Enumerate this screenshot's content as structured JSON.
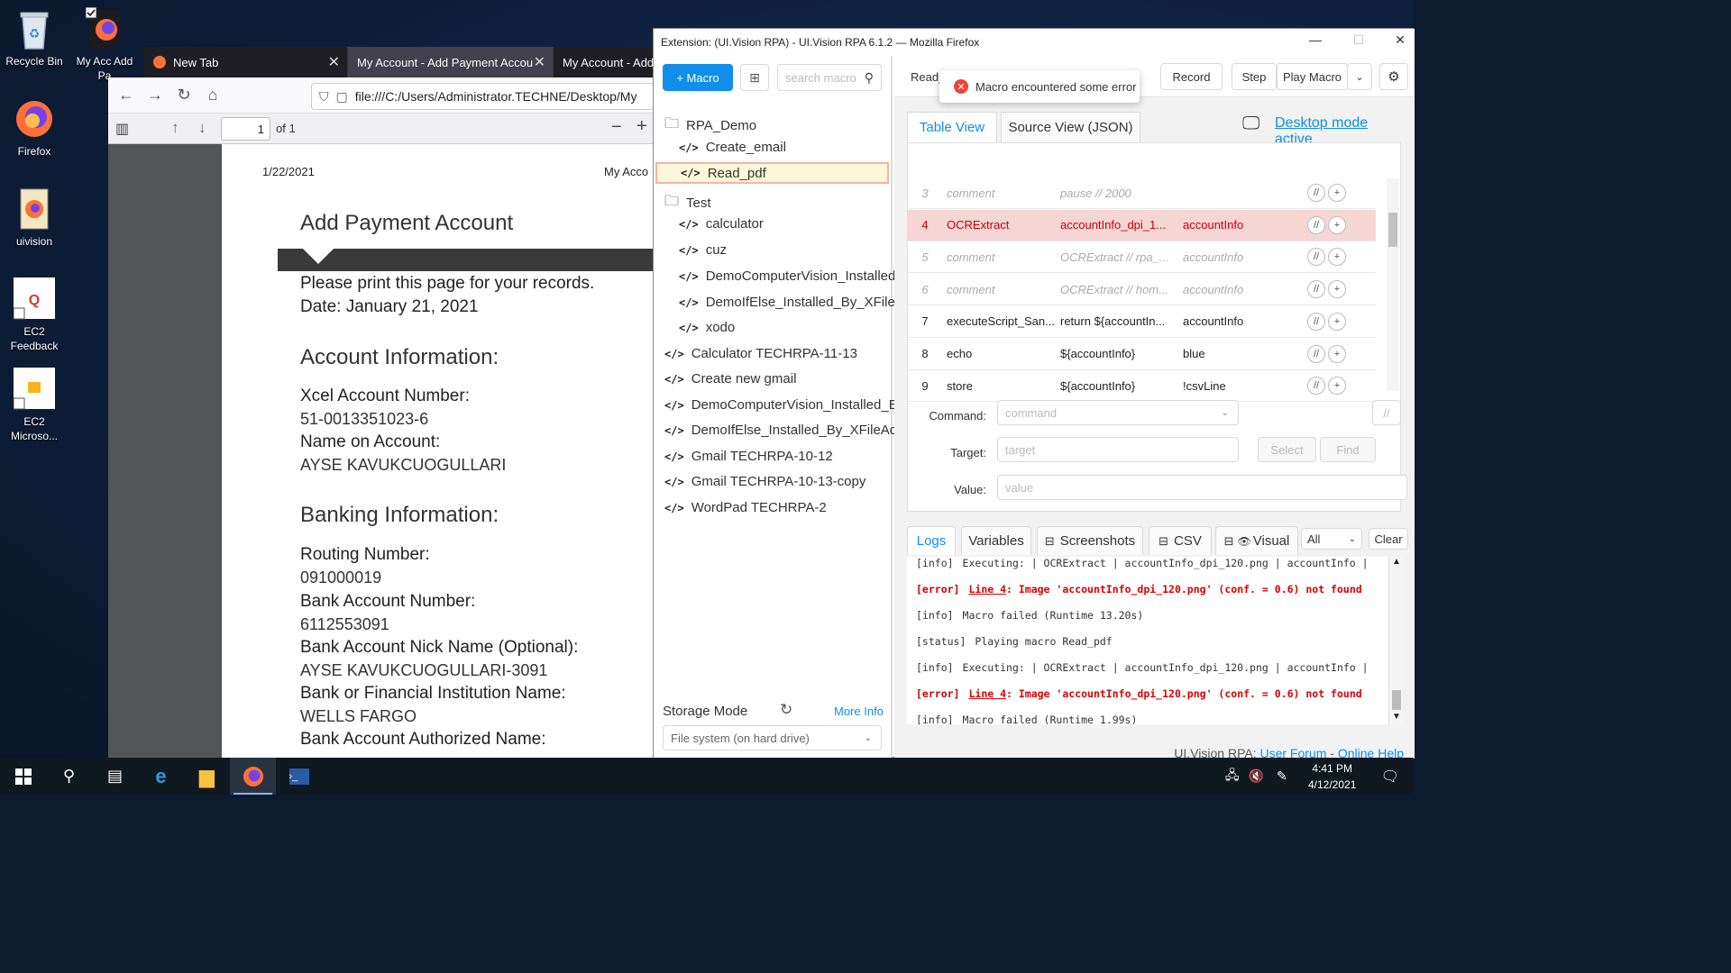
{
  "desktop": {
    "icons": [
      {
        "label": "Recycle Bin"
      },
      {
        "label": "My Acc Add Pa"
      },
      {
        "label": "Firefox"
      },
      {
        "label": "uivision"
      },
      {
        "label": "EC2 Feedback"
      },
      {
        "label": "EC2 Microso..."
      }
    ]
  },
  "firefox": {
    "tabs": [
      {
        "label": "New Tab"
      },
      {
        "label": "My Account - Add Payment Accoun"
      },
      {
        "label": "My Account - Add"
      }
    ],
    "url": "file:///C:/Users/Administrator.TECHNE/Desktop/My",
    "pdf": {
      "page_input": "1",
      "page_of": "of 1",
      "date_header": "1/22/2021",
      "title_header": "My Acco",
      "heading": "Add Payment Account",
      "print_note": "Please print this page for your records.",
      "date_label": "Date:",
      "date_value": "January 21, 2021",
      "account_info": "Account Information:",
      "xcel_label": "Xcel Account Number:",
      "xcel_value": "51-0013351023-6",
      "name_label": "Name on Account:",
      "name_value": "AYSE KAVUKCUOGULLARI",
      "banking_info": "Banking Information:",
      "routing_label": "Routing Number:",
      "routing_value": "091000019",
      "bank_acct_label": "Bank Account Number:",
      "bank_acct_value": "6112553091",
      "nick_label": "Bank Account Nick Name (Optional):",
      "nick_value": "AYSE KAVUKCUOGULLARI-3091",
      "inst_label": "Bank or Financial Institution Name:",
      "inst_value": "WELLS FARGO",
      "auth_label": "Bank Account Authorized Name:"
    }
  },
  "uivision": {
    "title": "Extension: (UI.Vision RPA) - UI.Vision RPA 6.1.2 — Mozilla Firefox",
    "add_macro": "+ Macro",
    "search_placeholder": "search macro",
    "tree": [
      {
        "label": "RPA_Demo",
        "type": "folder"
      },
      {
        "label": "Create_email",
        "type": "macro"
      },
      {
        "label": "Read_pdf",
        "type": "macro",
        "selected": true
      },
      {
        "label": "Test",
        "type": "folder"
      },
      {
        "label": "calculator",
        "type": "macro"
      },
      {
        "label": "cuz",
        "type": "macro"
      },
      {
        "label": "DemoComputerVision_Installed_By",
        "type": "macro"
      },
      {
        "label": "DemoIfElse_Installed_By_XFileAcce",
        "type": "macro"
      },
      {
        "label": "xodo",
        "type": "macro"
      },
      {
        "label": "Calculator TECHRPA-11-13",
        "type": "macro"
      },
      {
        "label": "Create new gmail",
        "type": "macro"
      },
      {
        "label": "DemoComputerVision_Installed_By_X",
        "type": "macro"
      },
      {
        "label": "DemoIfElse_Installed_By_XFileAccess",
        "type": "macro"
      },
      {
        "label": "Gmail TECHRPA-10-12",
        "type": "macro"
      },
      {
        "label": "Gmail TECHRPA-10-13-copy",
        "type": "macro"
      },
      {
        "label": "WordPad TECHRPA-2",
        "type": "macro"
      }
    ],
    "storage_label": "Storage Mode",
    "more_info": "More Info",
    "storage_value": "File system (on hard drive)",
    "toolbar": {
      "macro_name": "Read_",
      "record": "Record",
      "step": "Step",
      "play": "Play Macro"
    },
    "toast": "Macro encountered some error",
    "tabs": {
      "table": "Table View",
      "source": "Source View (JSON)"
    },
    "desktop_mode": "Desktop mode active",
    "rows": [
      {
        "n": "3",
        "cmd": "comment",
        "target": "pause // 2000",
        "value": "",
        "style": "comment"
      },
      {
        "n": "4",
        "cmd": "OCRExtract",
        "target": "accountInfo_dpi_1...",
        "value": "accountInfo",
        "style": "err"
      },
      {
        "n": "5",
        "cmd": "comment",
        "target": "OCRExtract // rpa_...",
        "value": "accountInfo",
        "style": "comment"
      },
      {
        "n": "6",
        "cmd": "comment",
        "target": "OCRExtract // hom...",
        "value": "accountInfo",
        "style": "comment"
      },
      {
        "n": "7",
        "cmd": "executeScript_San...",
        "target": "return ${accountIn...",
        "value": "accountInfo",
        "style": ""
      },
      {
        "n": "8",
        "cmd": "echo",
        "target": "${accountInfo}",
        "value": "blue",
        "style": ""
      },
      {
        "n": "9",
        "cmd": "store",
        "target": "${accountInfo}",
        "value": "!csvLine",
        "style": ""
      }
    ],
    "row_comment_btn": "//",
    "row_add_btn": "+",
    "editor": {
      "command_label": "Command:",
      "command_placeholder": "command",
      "target_label": "Target:",
      "target_placeholder": "target",
      "value_label": "Value:",
      "value_placeholder": "value",
      "select": "Select",
      "find": "Find",
      "comment_btn": "//"
    },
    "logtabs": {
      "logs": "Logs",
      "variables": "Variables",
      "screenshots": "Screenshots",
      "csv": "CSV",
      "visual": "Visual",
      "filter": "All",
      "clear": "Clear"
    },
    "logs": [
      {
        "tag": "[info]",
        "pre": "",
        "link": "",
        "msg": "Executing:  | OCRExtract | accountInfo_dpi_120.png | accountInfo |",
        "error": false
      },
      {
        "tag": "[error]",
        "pre": "",
        "link": "Line 4",
        "msg": ": Image 'accountInfo_dpi_120.png' (conf. = 0.6) not found",
        "error": true
      },
      {
        "tag": "[info]",
        "pre": "",
        "link": "",
        "msg": "Macro failed (Runtime 13.20s)",
        "error": false
      },
      {
        "tag": "[status]",
        "pre": "",
        "link": "",
        "msg": "Playing macro Read_pdf",
        "error": false
      },
      {
        "tag": "[info]",
        "pre": "",
        "link": "",
        "msg": "Executing:  | OCRExtract | accountInfo_dpi_120.png | accountInfo |",
        "error": false
      },
      {
        "tag": "[error]",
        "pre": "",
        "link": "Line 4",
        "msg": ": Image 'accountInfo_dpi_120.png' (conf. = 0.6) not found",
        "error": true
      },
      {
        "tag": "[info]",
        "pre": "",
        "link": "",
        "msg": "Macro failed (Runtime 1.99s)",
        "error": false
      }
    ],
    "footer": {
      "prefix": "UI.Vision RPA:",
      "forum": "User Forum",
      "sep": "-",
      "help": "Online Help"
    }
  },
  "taskbar": {
    "time": "4:41 PM",
    "date": "4/12/2021"
  }
}
